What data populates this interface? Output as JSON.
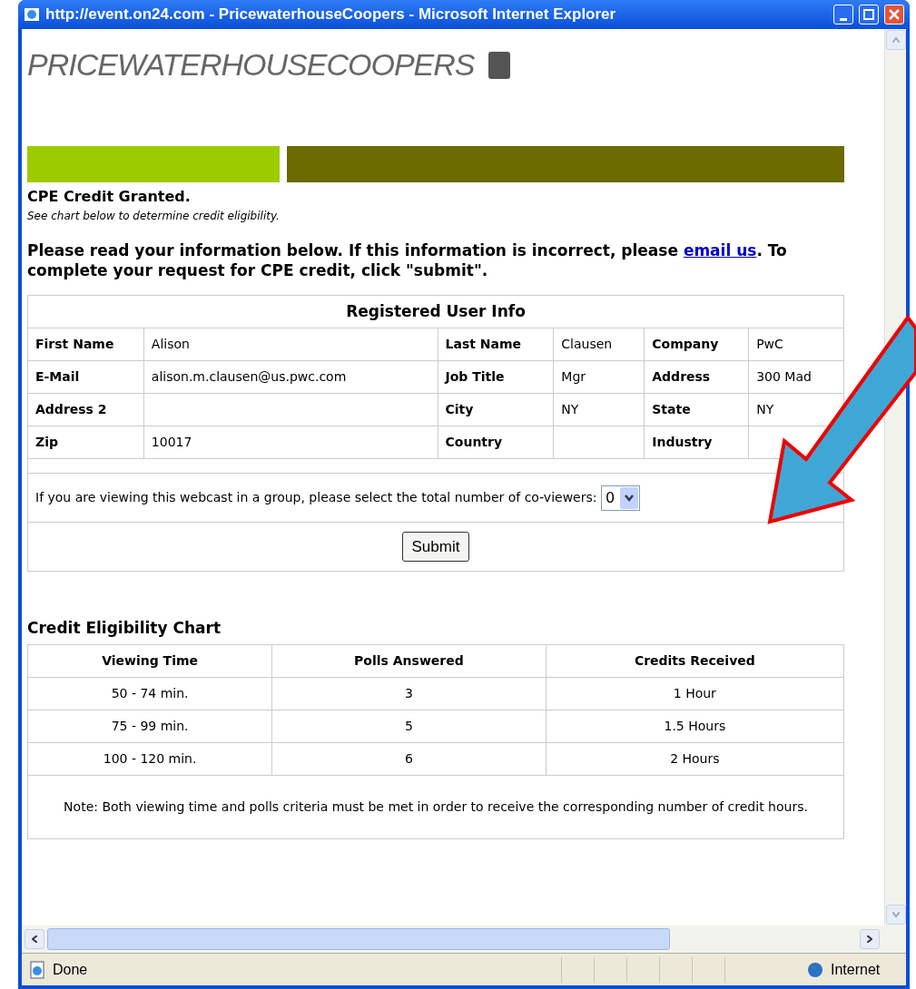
{
  "window": {
    "title": "http://event.on24.com - PricewaterhouseCoopers - Microsoft Internet Explorer"
  },
  "logo": {
    "text": "PRICEWATERHOUSECOOPERS"
  },
  "status": {
    "title": "CPE Credit Granted.",
    "note": "See chart below to determine credit eligibility."
  },
  "instructions": {
    "before": "Please read your information below. If this information is incorrect, please ",
    "link": "email us",
    "after": ". To complete your request for CPE credit, click \"submit\"."
  },
  "user_info": {
    "title": "Registered User Info",
    "rows": [
      [
        {
          "label": "First Name",
          "value": "Alison"
        },
        {
          "label": "Last Name",
          "value": "Clausen"
        },
        {
          "label": "Company",
          "value": "PwC"
        }
      ],
      [
        {
          "label": "E-Mail",
          "value": "alison.m.clausen@us.pwc.com"
        },
        {
          "label": "Job Title",
          "value": "Mgr"
        },
        {
          "label": "Address",
          "value": "300 Mad"
        }
      ],
      [
        {
          "label": "Address 2"
        },
        {
          "label": "City",
          "value": "NY"
        },
        {
          "label": "State",
          "value": "NY"
        }
      ],
      [
        {
          "label": "Zip",
          "value": "10017"
        },
        {
          "label": "Country"
        },
        {
          "label": "Industry"
        }
      ]
    ],
    "coviewers": {
      "label": "If you are viewing this webcast in a group, please select the total number of co-viewers:",
      "value": "0"
    },
    "submit": "Submit"
  },
  "eligibility": {
    "title": "Credit Eligibility Chart",
    "columns": [
      "Viewing Time",
      "Polls Answered",
      "Credits Received"
    ],
    "rows": [
      [
        "50 - 74 min.",
        "3",
        "1 Hour"
      ],
      [
        "75 - 99 min.",
        "5",
        "1.5 Hours"
      ],
      [
        "100 - 120 min.",
        "6",
        "2 Hours"
      ]
    ],
    "note": "Note: Both viewing time and polls criteria must be met in order to receive the corresponding number of credit hours."
  },
  "status_bar": {
    "text": "Done",
    "zone": "Internet"
  }
}
